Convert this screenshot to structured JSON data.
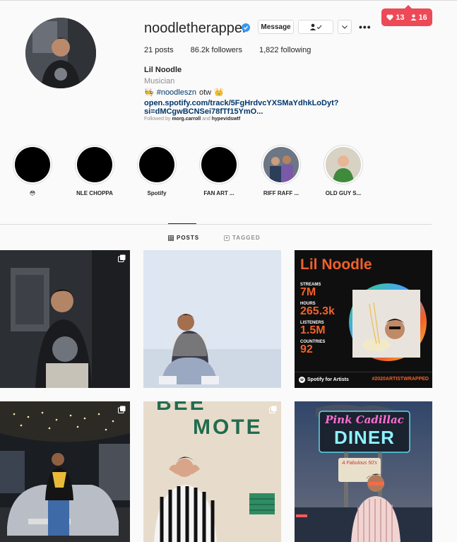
{
  "notifications": {
    "likes": "13",
    "followers": "16",
    "heart_icon": "heart-icon",
    "person_icon": "person-icon"
  },
  "profile": {
    "username": "noodletherapper",
    "buttons": {
      "message": "Message",
      "follow_icon": "person-check-icon",
      "chevron_icon": "chevron-down-icon",
      "more": "•••"
    },
    "stats": {
      "posts": "21 posts",
      "followers": "86.2k followers",
      "following": "1,822 following"
    },
    "name": "Lil Noodle",
    "category": "Musician",
    "bio": {
      "prefix_emoji": "🧑‍🍳",
      "hashtag": "#noodleszn",
      "rest": "otw",
      "suffix_emoji": "👑"
    },
    "link": "open.spotify.com/track/5FgHrdvcYXSMaYdhkLoDyt?si=dMCgwBCNSei78fTf15YmO...",
    "followed_by": {
      "prefix": "Followed by",
      "user1": "morg.carroll",
      "and": "and",
      "user2": "hypevidswtf"
    }
  },
  "highlights": [
    {
      "label": "😳"
    },
    {
      "label": "NLE CHOPPA"
    },
    {
      "label": "Spotify"
    },
    {
      "label": "FAN ART ..."
    },
    {
      "label": "RIFF RAFF ..."
    },
    {
      "label": "OLD GUY S..."
    }
  ],
  "tabs": {
    "posts": "POSTS",
    "tagged": "TAGGED"
  },
  "spotify_card": {
    "title": "Lil Noodle",
    "stats": [
      {
        "label": "STREAMS",
        "value": "7M"
      },
      {
        "label": "HOURS",
        "value": "265.3k"
      },
      {
        "label": "LISTENERS",
        "value": "1.5M"
      },
      {
        "label": "COUNTRIES",
        "value": "92"
      }
    ],
    "brand": "Spotify for Artists",
    "hashtag": "#2020ARTISTWRAPPED"
  },
  "motel_sign": {
    "top": "BEE",
    "mid": "MOTE"
  },
  "diner_sign": {
    "top": "Pink Cadillac",
    "mid": "DINER",
    "sub": "A Fabulous 50's"
  },
  "colors": {
    "accent": "#ed4956",
    "link": "#00376b",
    "verified": "#3897f0",
    "spotify_orange": "#f1612a"
  }
}
